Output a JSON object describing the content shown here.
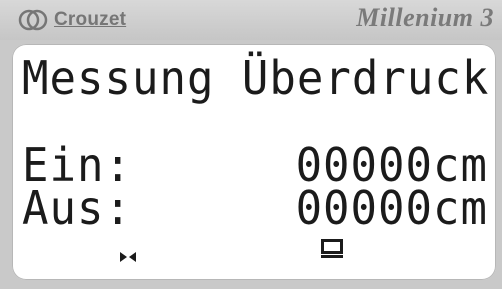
{
  "header": {
    "brand": "Crouzet",
    "model": "Millenium 3",
    "logo_icon": "crouzet-logo-icon"
  },
  "display": {
    "title": "Messung Überdruck",
    "rows": [
      {
        "label": "Ein:",
        "value": "00000cm"
      },
      {
        "label": "Aus:",
        "value": "00000cm"
      }
    ],
    "status_icons": [
      "bowtie-icon",
      "monitor-icon"
    ]
  },
  "colors": {
    "frame": "#c9c9c9",
    "lcd_background": "#ffffff",
    "lcd_text": "#1b1b1b",
    "brand_text": "#767676"
  }
}
